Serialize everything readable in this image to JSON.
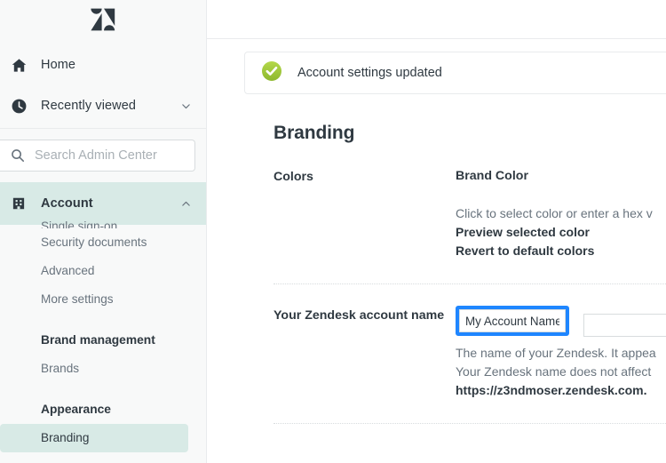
{
  "sidebar": {
    "logo_name": "zendesk-logo",
    "nav": [
      {
        "label": "Home",
        "icon": "home-icon",
        "name": "sidebar-item-home"
      },
      {
        "label": "Recently viewed",
        "icon": "clock-icon",
        "name": "sidebar-item-recently-viewed",
        "chevron": "chevron-down-icon"
      }
    ],
    "search": {
      "placeholder": "Search Admin Center",
      "value": "",
      "icon": "search-icon"
    },
    "account_section": {
      "label": "Account",
      "icon": "building-icon",
      "chevron": "chevron-up-icon",
      "expanded": true
    },
    "sub_items_clipped": "Single sign-on",
    "sub_items": [
      {
        "label": "Security documents",
        "active": false
      },
      {
        "label": "Advanced",
        "active": false
      },
      {
        "label": "More settings",
        "active": false
      }
    ],
    "groups": [
      {
        "heading": "Brand management",
        "items": [
          {
            "label": "Brands",
            "active": false
          }
        ]
      },
      {
        "heading": "Appearance",
        "items": [
          {
            "label": "Branding",
            "active": true
          }
        ]
      }
    ]
  },
  "main": {
    "banner": {
      "text": "Account settings updated",
      "icon": "success-check-icon",
      "icon_color": "#8bc34a"
    },
    "page_title": "Branding",
    "sections": {
      "colors": {
        "label": "Colors",
        "field_title": "Brand Color",
        "helper": "Click to select color or enter a hex v",
        "links": [
          "Preview selected color",
          "Revert to default colors"
        ]
      },
      "account_name": {
        "label": "Your Zendesk account name",
        "input_value": "My Account Name",
        "input_placeholder": "",
        "helper_line_1": "The name of your Zendesk. It appea",
        "helper_line_2": "Your Zendesk name does not affect",
        "helper_line_3": "https://z3ndmoser.zendesk.com."
      }
    }
  },
  "colors": {
    "focus_ring": "#1f86ff",
    "sidebar_bg": "#f8f9f9",
    "active_item_bg": "#d8eae6",
    "text_primary": "#2f3941",
    "text_secondary": "#68737d",
    "border": "#e9ebed"
  }
}
